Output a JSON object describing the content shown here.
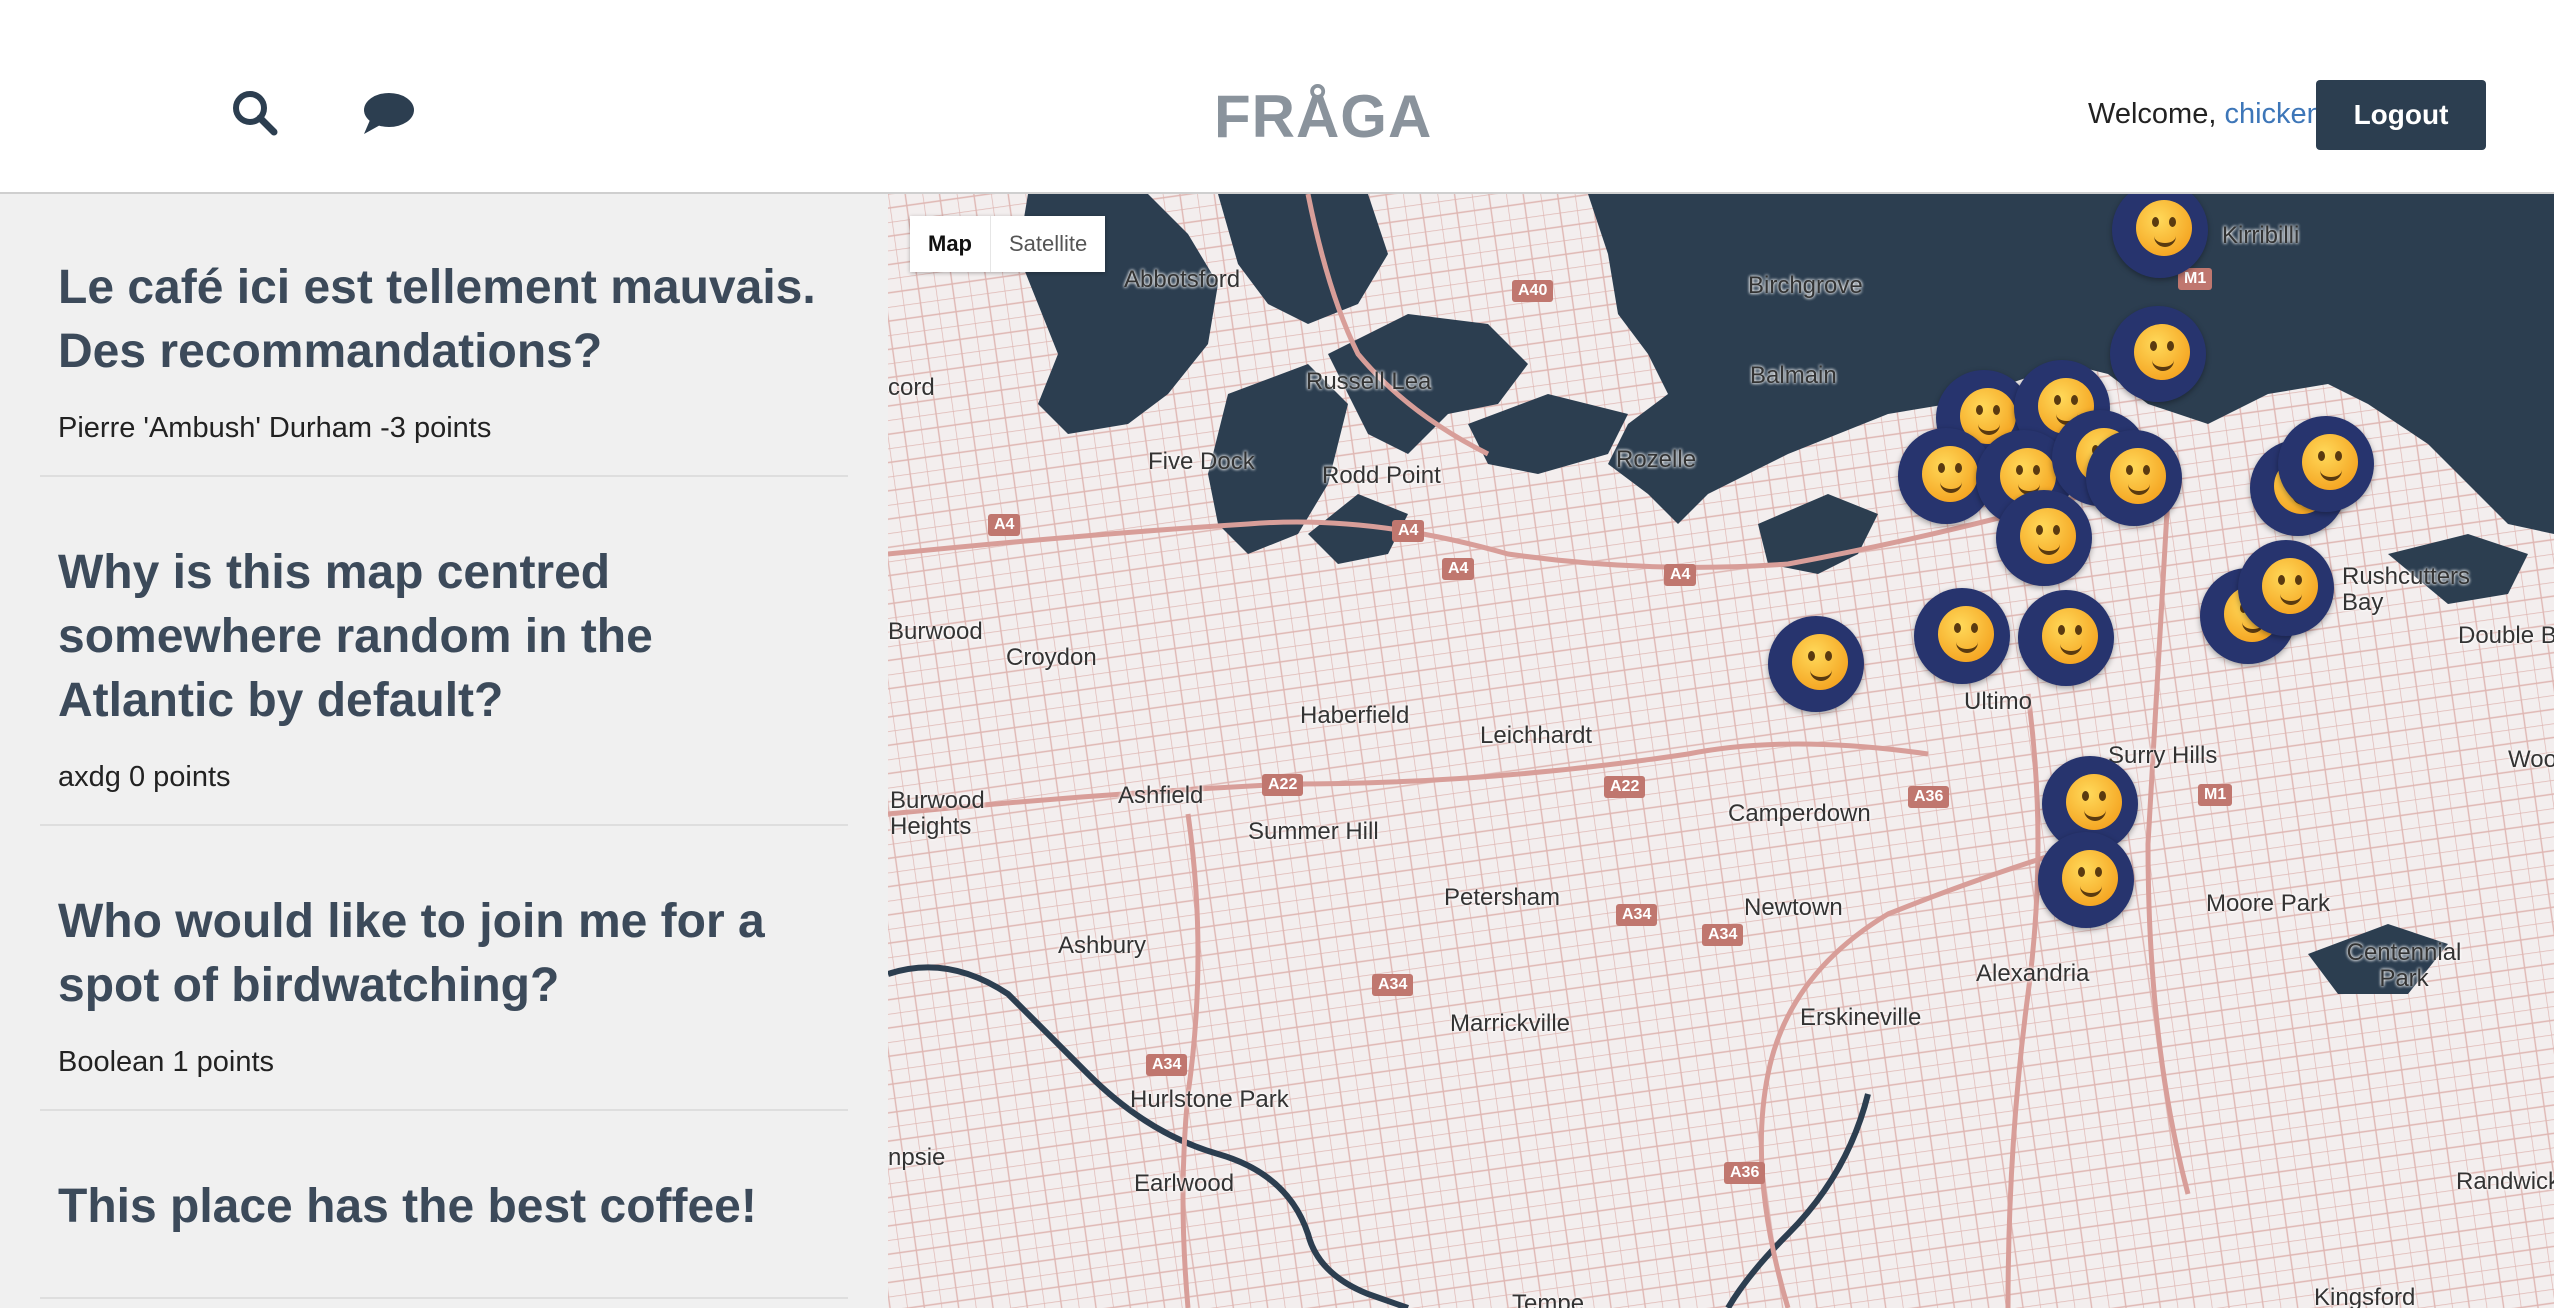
{
  "header": {
    "brand": "FRÅGA",
    "welcome_prefix": "Welcome, ",
    "username": "chicken",
    "logout_label": "Logout",
    "search_icon": "search-icon",
    "chat_icon": "chat-icon"
  },
  "posts": [
    {
      "title": " Le café ici est tellement mauvais. Des recommandations?",
      "meta": "Pierre 'Ambush' Durham -3 points"
    },
    {
      "title": "Why is this map centred somewhere random in the Atlantic by default?",
      "meta": "axdg 0 points"
    },
    {
      "title": "Who would like to join me for a spot of birdwatching?",
      "meta": "Boolean 1 points"
    },
    {
      "title": "This place has the best coffee!",
      "meta": ""
    }
  ],
  "map": {
    "type_map": "Map",
    "type_satellite": "Satellite",
    "places": [
      "Abbotsford",
      "Birchgrove",
      "Balmain",
      "Russell Lea",
      "Five Dock",
      "Rodd Point",
      "Rozelle",
      "Burwood",
      "Croydon",
      "Haberfield",
      "Leichhardt",
      "Ultimo",
      "Surry Hills",
      "Ashfield",
      "Summer Hill",
      "Camperdown",
      "Burwood Heights",
      "Petersham",
      "Newtown",
      "Moore Park",
      "Ashbury",
      "Alexandria",
      "Centennial Park",
      "Marrickville",
      "Erskineville",
      "Hurlstone Park",
      "Earlwood",
      "Randwick",
      "Kingsford",
      "Tempe",
      "Double Bay",
      "Rushcutters Bay",
      "Kirribilli",
      "Woollahra",
      "cord",
      "npsie"
    ],
    "roads": [
      "A40",
      "M1",
      "A4",
      "A4",
      "A4",
      "A4",
      "A22",
      "A22",
      "A36",
      "M1",
      "A34",
      "A34",
      "A34",
      "A34",
      "A36"
    ]
  },
  "colors": {
    "water": "#2c3e50",
    "marker_bg": "#27346e",
    "road": "#d6a5a1",
    "logout_bg": "#2c3e50",
    "link": "#3d76b8"
  }
}
